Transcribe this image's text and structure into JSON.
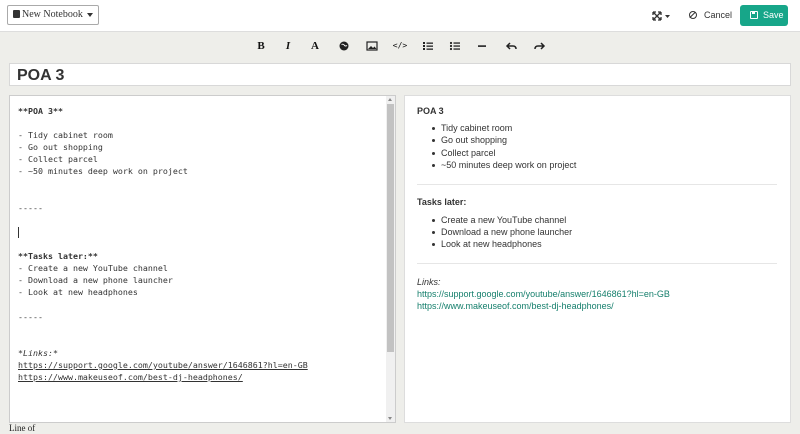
{
  "topbar": {
    "notebook_label": "New Notebook",
    "cancel_label": "Cancel",
    "save_label": "Save",
    "expand_icon": "expand-arrows-icon"
  },
  "toolbar": {
    "bold": "B",
    "italic": "I",
    "text_style": "A",
    "link_icon": "globe-icon",
    "image_icon": "image-icon",
    "code": "</>",
    "ordered_list_icon": "ordered-list-icon",
    "unordered_list_icon": "unordered-list-icon",
    "hr_icon": "horizontal-rule-icon",
    "undo_icon": "undo-icon",
    "redo_icon": "redo-icon"
  },
  "note": {
    "title": "POA 3"
  },
  "editor": {
    "lines": [
      "**POA 3**",
      "- Tidy cabinet room",
      "- Go out shopping",
      "- Collect parcel",
      "- ~50 minutes deep work on project",
      "-----",
      "**Tasks later:**",
      "- Create a new YouTube channel",
      "- Download a new phone launcher",
      "- Look at new headphones",
      "-----",
      "*Links:*",
      "https://support.google.com/youtube/answer/1646861?hl=en-GB",
      "https://www.makeuseof.com/best-dj-headphones/"
    ]
  },
  "preview": {
    "heading1": "POA 3",
    "list1": [
      "Tidy cabinet room",
      "Go out shopping",
      "Collect parcel",
      "~50 minutes deep work on project"
    ],
    "heading2": "Tasks later:",
    "list2": [
      "Create a new YouTube channel",
      "Download a new phone launcher",
      "Look at new headphones"
    ],
    "links_label": "Links:",
    "links": [
      "https://support.google.com/youtube/answer/1646861?hl=en-GB",
      "https://www.makeuseof.com/best-dj-headphones/"
    ]
  },
  "status": {
    "text": "Line of"
  },
  "colors": {
    "accent": "#17a689",
    "link": "#157f6c"
  }
}
